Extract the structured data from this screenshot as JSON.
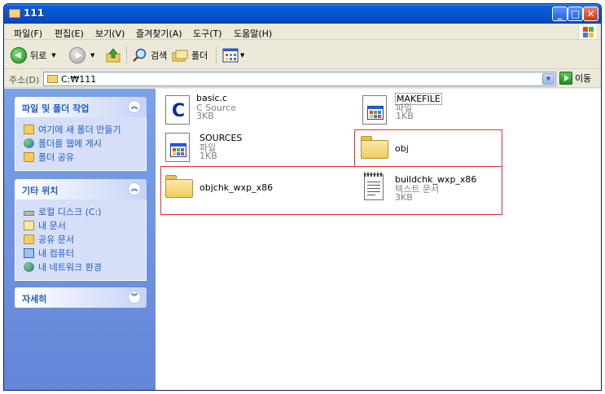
{
  "window": {
    "title": "111"
  },
  "menu": [
    "파일(F)",
    "편집(E)",
    "보기(V)",
    "즐겨찾기(A)",
    "도구(T)",
    "도움말(H)"
  ],
  "toolbar": {
    "back": "뒤로",
    "search": "검색",
    "folders": "폴더"
  },
  "address": {
    "label": "주소(D)",
    "path": "C:₩111",
    "go": "이동"
  },
  "sidebar": {
    "tasks": {
      "title": "파일 및 폴더 작업",
      "items": [
        "여기에 새 폴더 만들기",
        "폴더를 웹에 게시",
        "폴더 공유"
      ]
    },
    "places": {
      "title": "기타 위치",
      "items": [
        "로컬 디스크 (C:)",
        "내 문서",
        "공유 문서",
        "내 컴퓨터",
        "내 네트워크 환경"
      ]
    },
    "details": {
      "title": "자세히"
    }
  },
  "files": [
    {
      "name": "basic.c",
      "type": "C Source",
      "size": "3KB",
      "icon": "c-source-icon"
    },
    {
      "name": "MAKEFILE",
      "type": "파일",
      "size": "1KB",
      "icon": "generic-file-icon"
    },
    {
      "name": "SOURCES",
      "type": "파일",
      "size": "1KB",
      "icon": "generic-file-icon"
    },
    {
      "name": "obj",
      "icon": "folder-icon"
    },
    {
      "name": "objchk_wxp_x86",
      "icon": "folder-icon"
    },
    {
      "name": "buildchk_wxp_x86",
      "type": "텍스트 문서",
      "size": "3KB",
      "icon": "text-document-icon"
    }
  ],
  "colors": {
    "titlebar": "#0a55d0",
    "highlight_box": "#e03030",
    "sidebar_link": "#215dc6"
  }
}
